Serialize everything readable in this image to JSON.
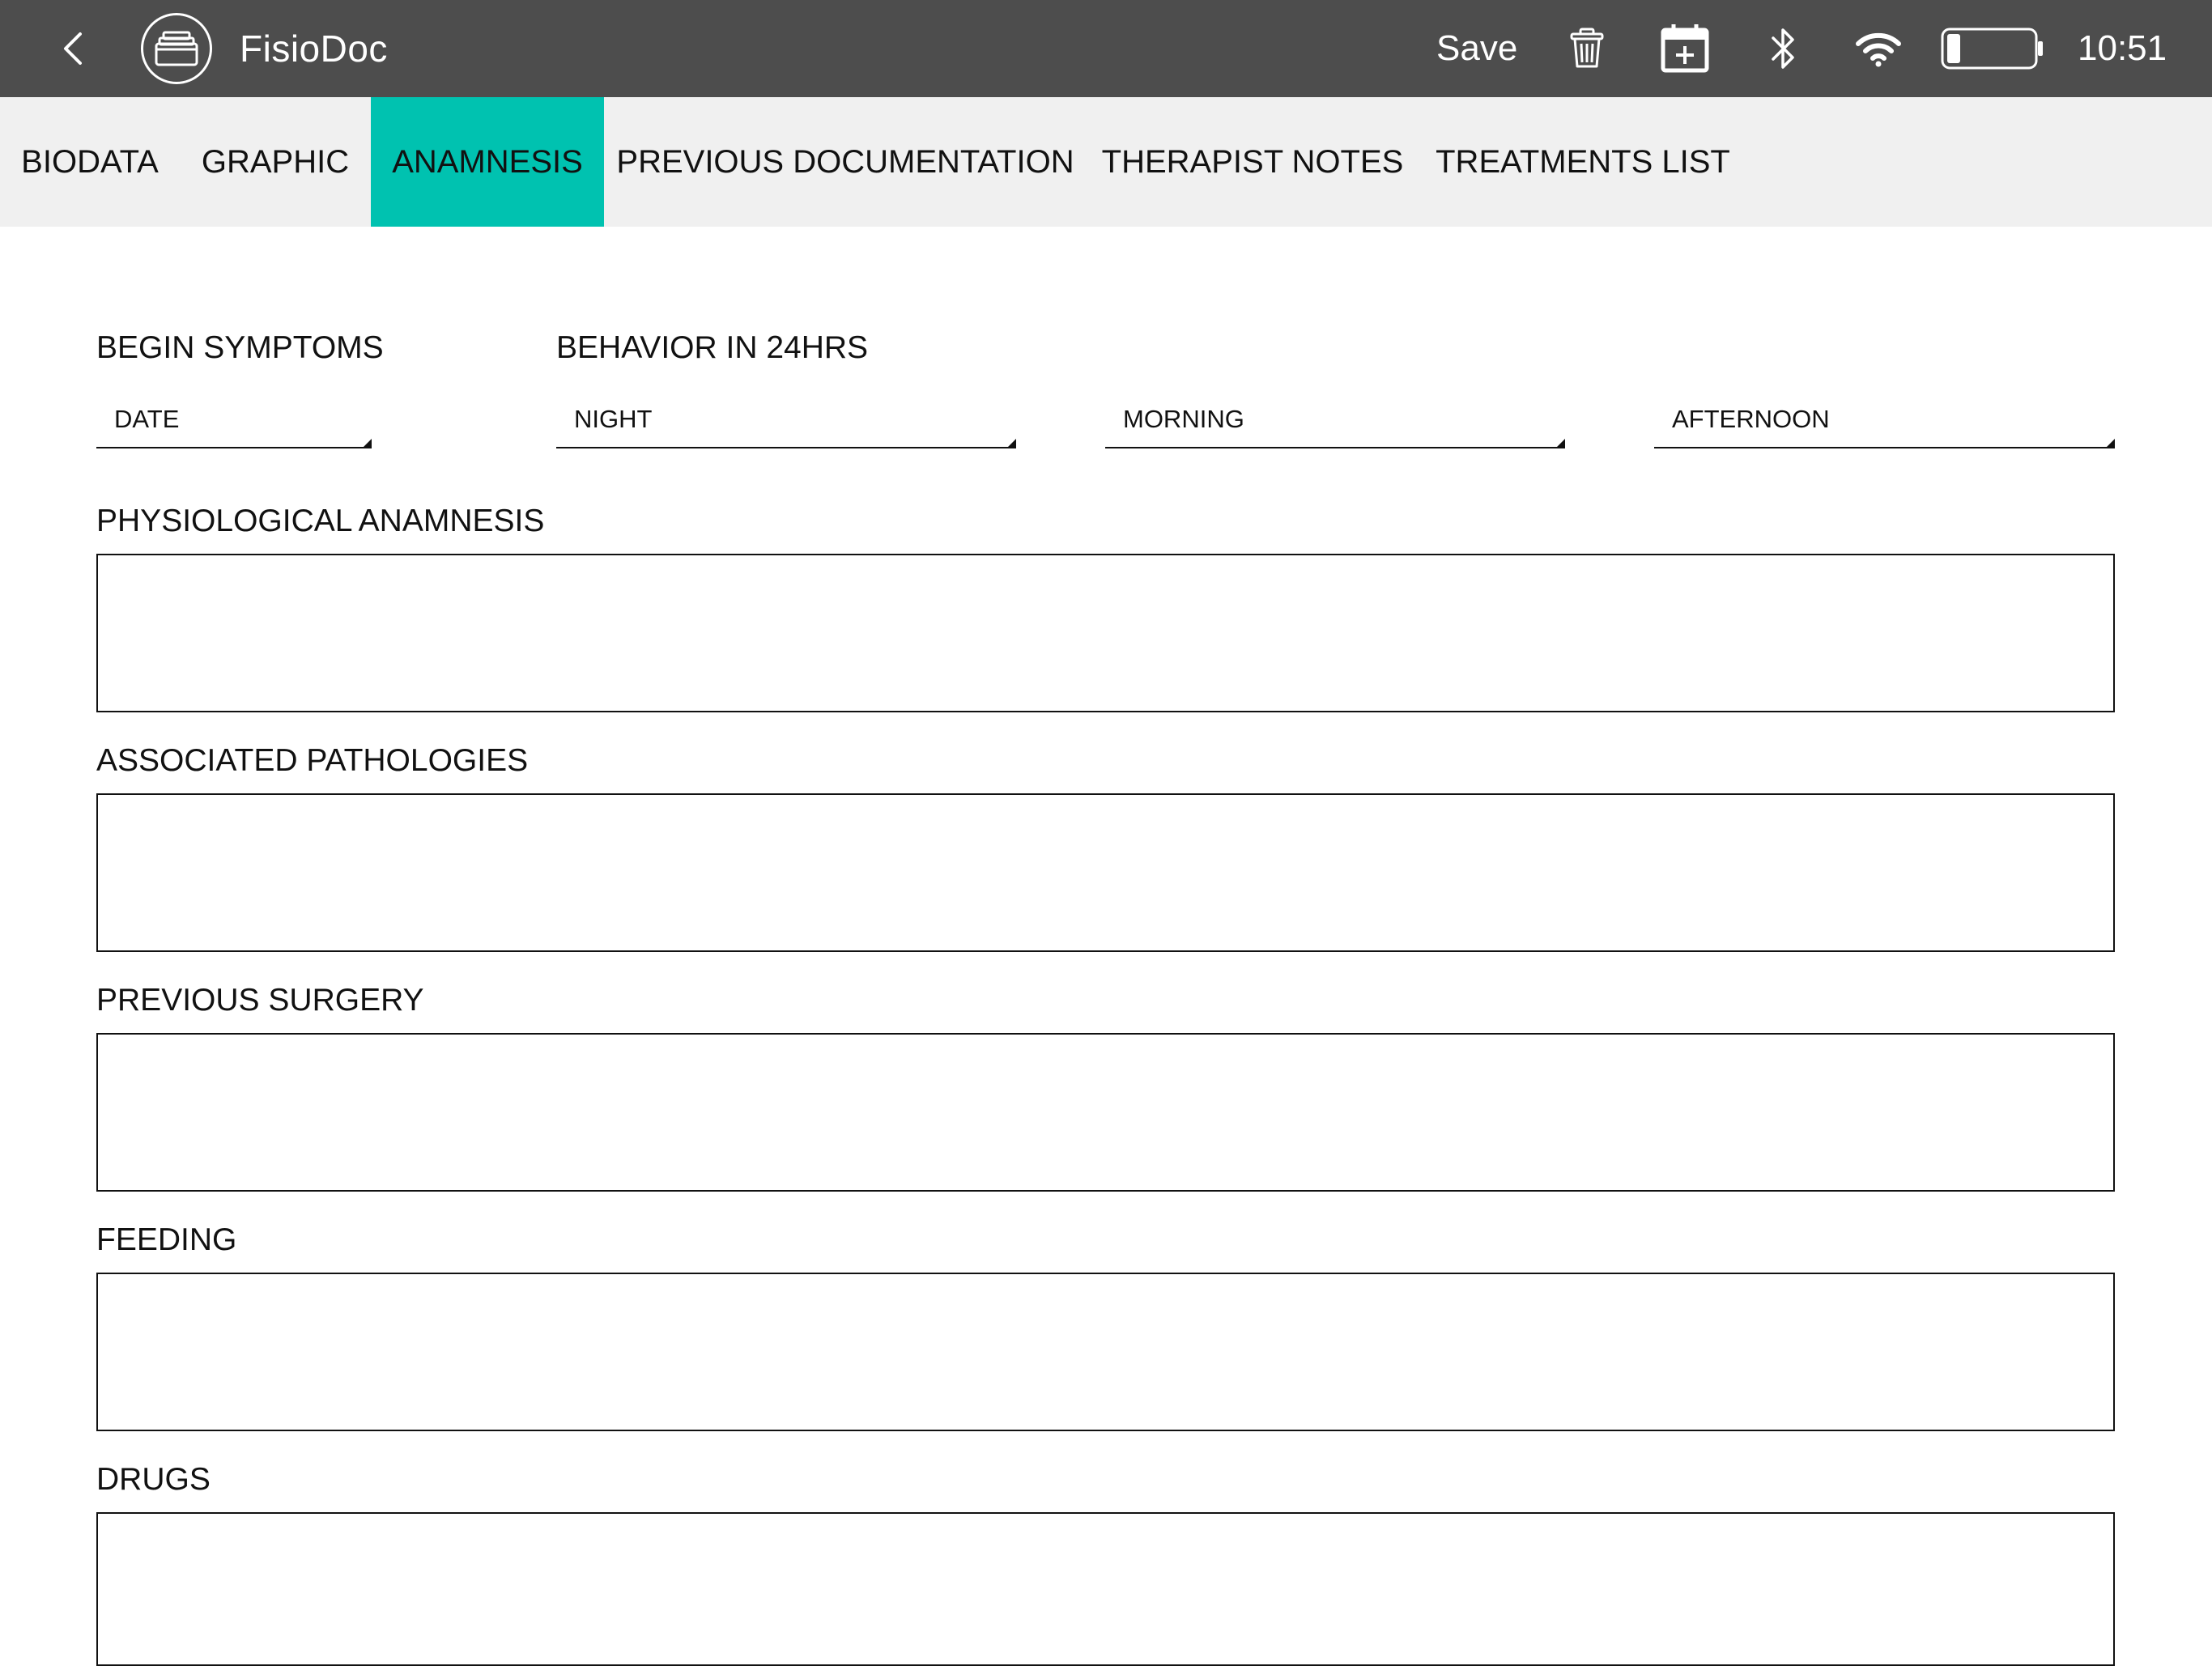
{
  "app": {
    "title": "FisioDoc",
    "save_label": "Save",
    "time": "10:51",
    "battery_level": 0.15,
    "icons": {
      "back": "chevron-left-icon",
      "logo": "folder-tray-icon",
      "delete": "trash-icon",
      "calendar": "calendar-add-icon",
      "bluetooth": "bluetooth-icon",
      "wifi": "wifi-icon",
      "battery": "battery-icon"
    }
  },
  "tabs": [
    {
      "label": "BIODATA",
      "active": false
    },
    {
      "label": "GRAPHIC",
      "active": false
    },
    {
      "label": "ANAMNESIS",
      "active": true
    },
    {
      "label": "PREVIOUS DOCUMENTATION",
      "active": false
    },
    {
      "label": "THERAPIST NOTES",
      "active": false
    },
    {
      "label": "TREATMENTS LIST",
      "active": false
    }
  ],
  "form": {
    "begin_symptoms": {
      "label": "BEGIN SYMPTOMS",
      "date_placeholder": "DATE"
    },
    "behavior": {
      "label": "BEHAVIOR IN 24HRS",
      "night": "NIGHT",
      "morning": "MORNING",
      "afternoon": "AFTERNOON"
    },
    "fields": [
      {
        "label": "PHYSIOLOGICAL ANAMNESIS",
        "value": ""
      },
      {
        "label": "ASSOCIATED PATHOLOGIES",
        "value": ""
      },
      {
        "label": "PREVIOUS SURGERY",
        "value": ""
      },
      {
        "label": "FEEDING",
        "value": ""
      },
      {
        "label": "DRUGS",
        "value": ""
      }
    ]
  },
  "colors": {
    "appbar": "#4d4d4d",
    "tabbar": "#f0f0f0",
    "active_tab": "#00c2b0"
  }
}
